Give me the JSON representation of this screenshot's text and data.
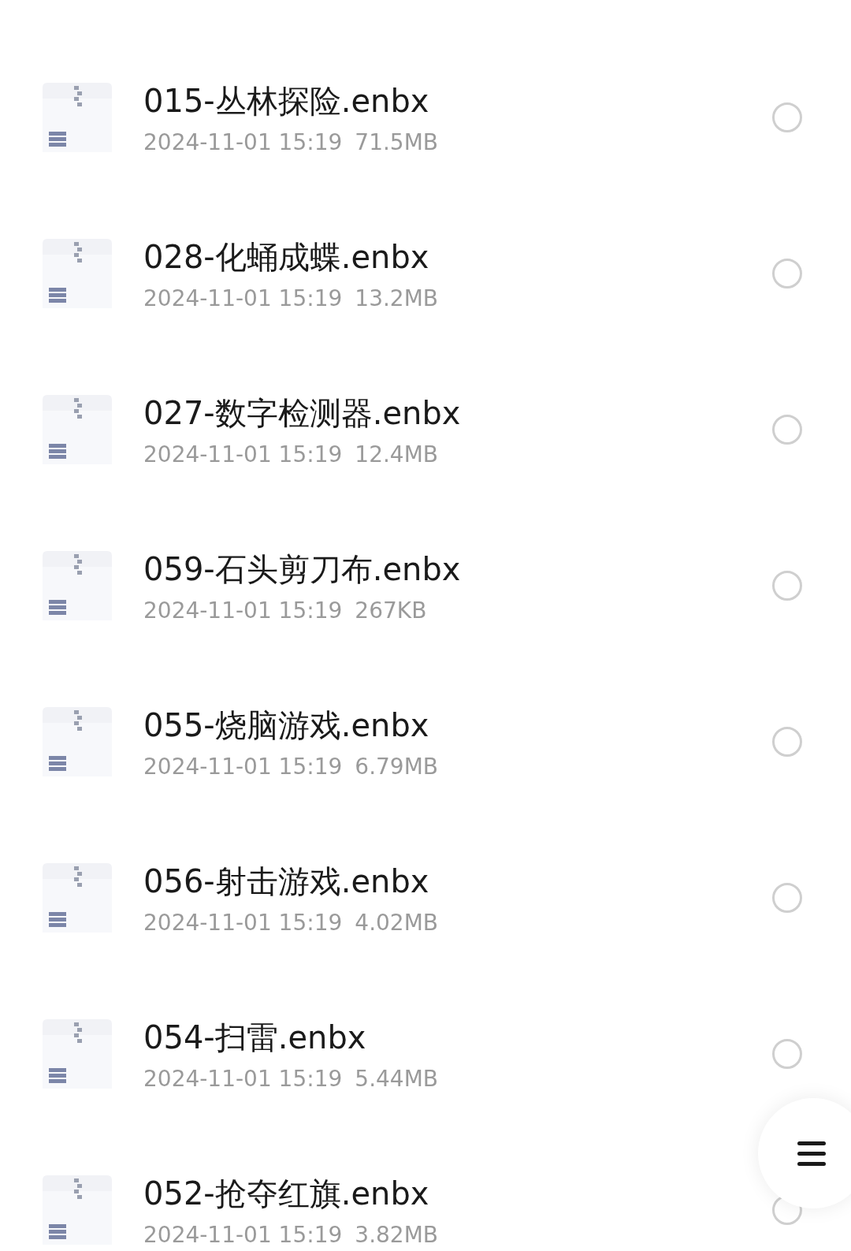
{
  "files": [
    {
      "name": "015-丛林探险.enbx",
      "date": "2024-11-01 15:19",
      "size": "71.5MB",
      "selected": false
    },
    {
      "name": "028-化蛹成蝶.enbx",
      "date": "2024-11-01 15:19",
      "size": "13.2MB",
      "selected": false
    },
    {
      "name": "027-数字检测器.enbx",
      "date": "2024-11-01 15:19",
      "size": "12.4MB",
      "selected": false
    },
    {
      "name": "059-石头剪刀布.enbx",
      "date": "2024-11-01 15:19",
      "size": "267KB",
      "selected": false
    },
    {
      "name": "055-烧脑游戏.enbx",
      "date": "2024-11-01 15:19",
      "size": "6.79MB",
      "selected": false
    },
    {
      "name": "056-射击游戏.enbx",
      "date": "2024-11-01 15:19",
      "size": "4.02MB",
      "selected": false
    },
    {
      "name": "054-扫雷.enbx",
      "date": "2024-11-01 15:19",
      "size": "5.44MB",
      "selected": false
    },
    {
      "name": "052-抢夺红旗.enbx",
      "date": "2024-11-01 15:19",
      "size": "3.82MB",
      "selected": false
    }
  ]
}
